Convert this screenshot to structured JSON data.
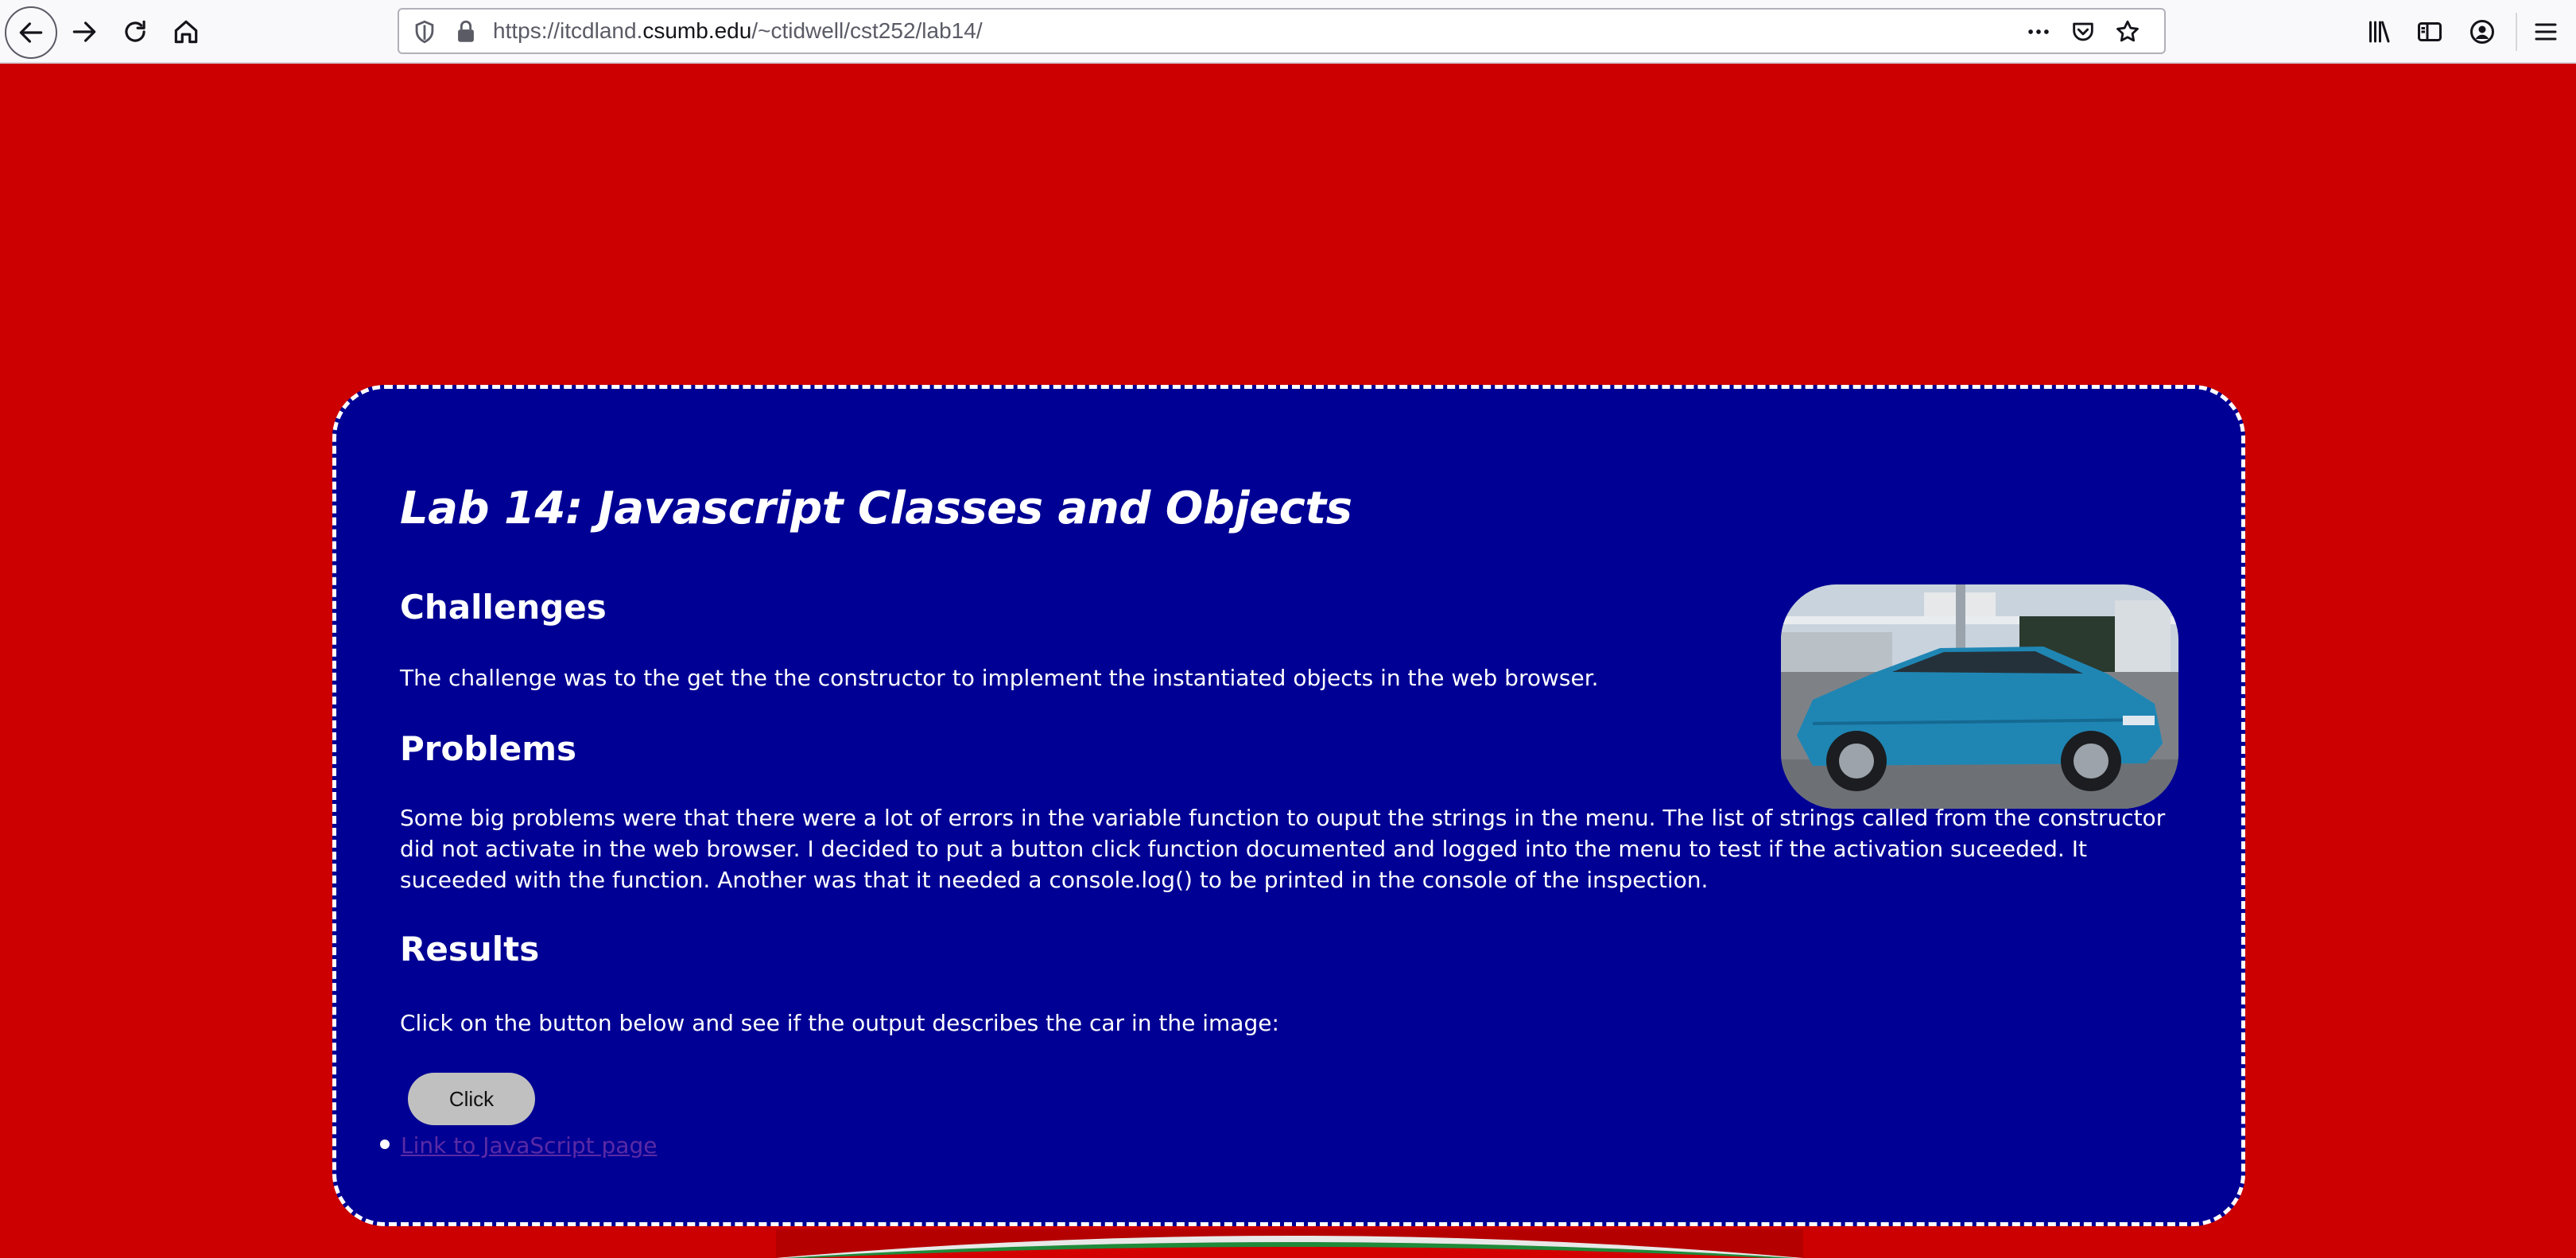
{
  "browser": {
    "url_prefix": "https://itcdland.",
    "url_domain": "csumb.edu",
    "url_path": "/~ctidwell/cst252/lab14/"
  },
  "page": {
    "title": "Lab 14: Javascript Classes and Objects",
    "challenges_heading": "Challenges",
    "challenges_text": "The challenge was to the get the the constructor to implement the instantiated objects in the web browser.",
    "problems_heading": "Problems",
    "problems_text": "Some big problems were that there were a lot of errors in the variable function to ouput the strings in the menu. The list of strings called from the constructor did not activate in the web browser. I decided to put a button click function documented and logged into the menu to test if the activation suceeded. It suceeded with the function. Another was that it needed a console.log() to be printed in the console of the inspection.",
    "results_heading": "Results",
    "results_text": "Click on the button below and see if the output describes the car in the image:",
    "button_label": "Click",
    "link_text": "Link to JavaScript page"
  },
  "colors": {
    "page_background": "#cc0000",
    "card_background": "#000094",
    "card_border": "#ffffff",
    "button": "#c0c0c0",
    "link": "#5a2aa5"
  },
  "icons": [
    "back-arrow-icon",
    "forward-arrow-icon",
    "reload-icon",
    "home-icon",
    "tracking-shield-icon",
    "lock-icon",
    "more-actions-icon",
    "pocket-icon",
    "bookmark-star-icon",
    "library-icon",
    "sidebar-icon",
    "account-icon",
    "hamburger-menu-icon"
  ]
}
